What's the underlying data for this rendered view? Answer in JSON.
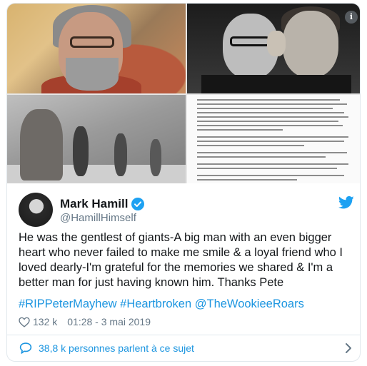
{
  "media": {
    "info_icon": "info-icon",
    "info_glyph": "i"
  },
  "author": {
    "display_name": "Mark Hamill",
    "handle": "@HamillHimself",
    "verified_icon": "verified-badge-icon",
    "brand_icon": "twitter-bird-icon"
  },
  "tweet": {
    "text": "He was the gentlest of giants-A big man with an even bigger heart who never failed to make me smile & a loyal friend who I loved dearly-I'm grateful for the memories we shared & I'm a better man for just having known him. Thanks Pete",
    "hashtags": [
      "#RIPPeterMayhew",
      "#Heartbroken",
      "@TheWookieeRoars"
    ],
    "likes": "132 k",
    "timestamp": "01:28 - 3 mai 2019"
  },
  "footer": {
    "conversation": "38,8 k personnes parlent à ce sujet"
  },
  "colors": {
    "link": "#1b95e0",
    "verified": "#1da1f2",
    "secondary_text": "#657786"
  }
}
